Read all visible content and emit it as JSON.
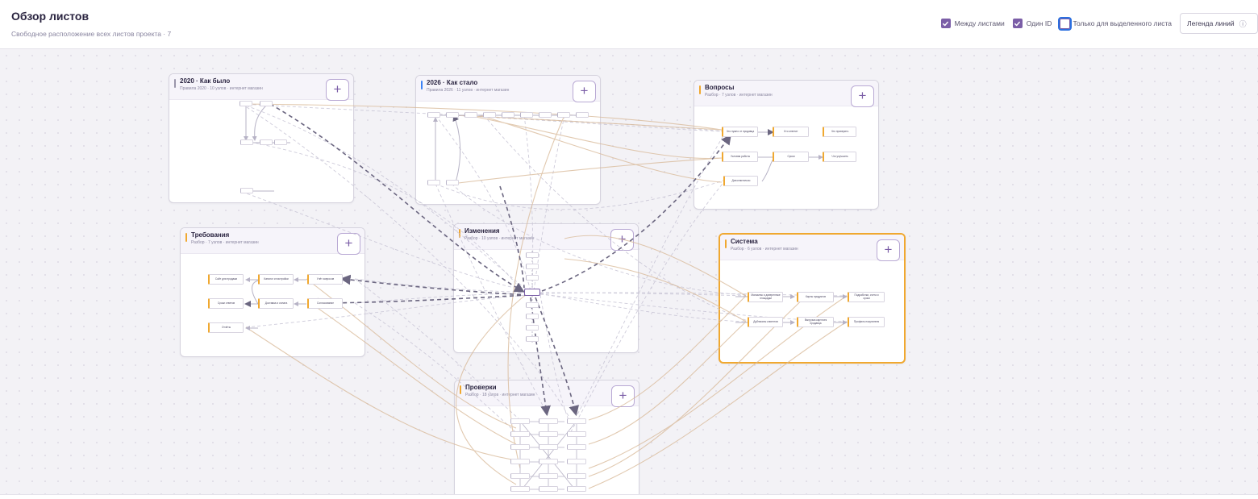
{
  "header": {
    "title": "Обзор листов",
    "subtitle": "Свободное расположение всех листов проекта · 7",
    "toggles": [
      {
        "label": "Между листами",
        "checked": true
      },
      {
        "label": "Один ID",
        "checked": true
      },
      {
        "label": "Только для выделенного листа",
        "checked": false
      }
    ],
    "legend_button": "Легенда линий",
    "info_icon": "ⓘ"
  },
  "colors": {
    "accent": "#7b5ea7",
    "orange": "#f0a830",
    "blue": "#3b82f6",
    "gray": "#9a96aa",
    "edge_dark": "#6b6680",
    "edge_light": "#c9c6d6",
    "edge_tan": "#d8b896"
  },
  "sheets": [
    {
      "id": "s2020",
      "title": "2020 · Как было",
      "meta": "Правила 2020 · 10 узлов · интернет магазин",
      "bar_color": "#9a96aa"
    },
    {
      "id": "s2026",
      "title": "2026 · Как стало",
      "meta": "Правила 2026 · 11 узлов · интернет магазин",
      "bar_color": "#3b82f6"
    },
    {
      "id": "questions",
      "title": "Вопросы",
      "meta": "Разбор · 7 узлов · интернет магазин",
      "bar_color": "#f0a830"
    },
    {
      "id": "requirements",
      "title": "Требования",
      "meta": "Разбор · 7 узлов · интернет магазин",
      "bar_color": "#f0a830"
    },
    {
      "id": "changes",
      "title": "Изменения",
      "meta": "Разбор · 10 узлов · интернет магазин",
      "bar_color": "#f0a830"
    },
    {
      "id": "system",
      "title": "Система",
      "meta": "Разбор · 6 узлов · интернет магазин",
      "bar_color": "#f0a830",
      "selected": true
    },
    {
      "id": "checks",
      "title": "Проверки",
      "meta": "Разбор · 18 узлов · интернет магазин",
      "bar_color": "#f0a830"
    }
  ],
  "add_label": "+",
  "system_nodes": [
    "Магазины и доверенные площадки",
    "Карты продуктов",
    "Подработки, счета и сроки",
    "Дубликаты клиентов",
    "Выгрузка карточек продавца",
    "Профиль покупателя"
  ],
  "requirement_nodes": [
    "Сайт для продажи",
    "Каталог и настройки",
    "Учёт запросов",
    "Сроки ответов",
    "Доставка и оплата",
    "Согласование",
    "Отчёты"
  ],
  "question_nodes": [
    "Что нужно от продавца",
    "Кто ответит",
    "Что проверить",
    "Условия работы",
    "Сроки",
    "Что улучшить",
    "Дополнительно"
  ]
}
